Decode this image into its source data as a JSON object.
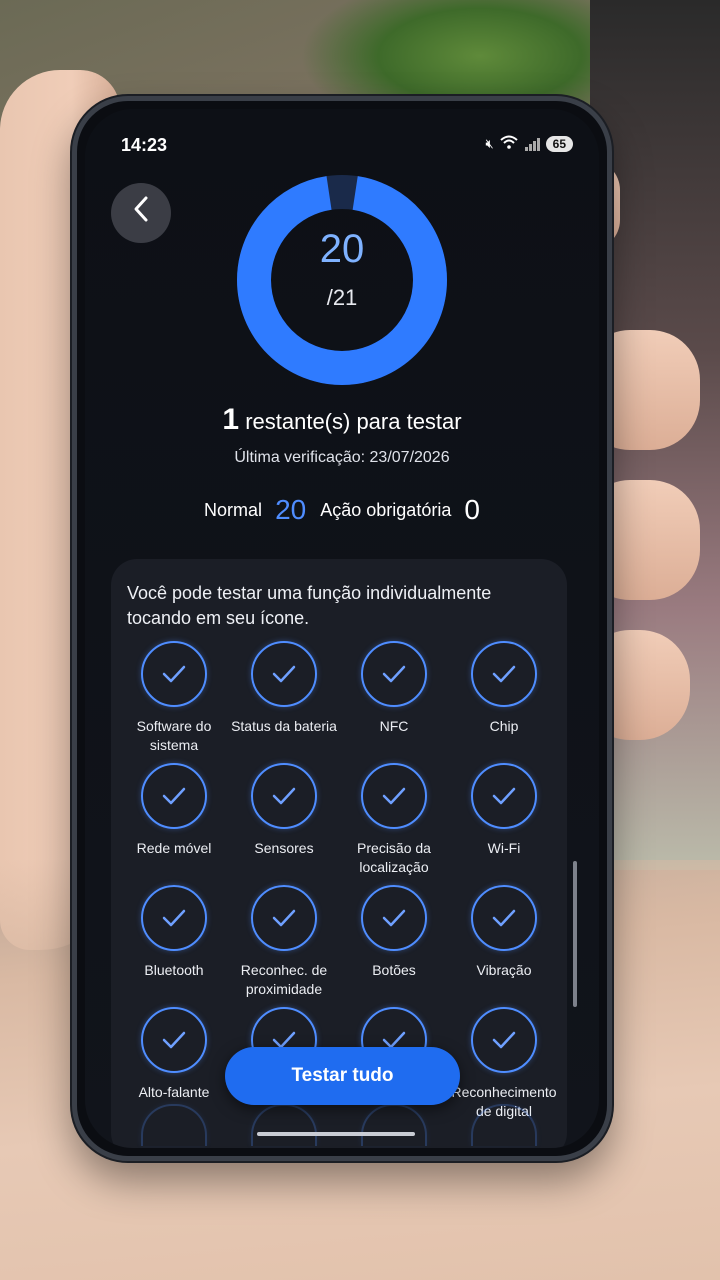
{
  "status_bar": {
    "time": "14:23",
    "battery": "65"
  },
  "progress": {
    "completed": "20",
    "total": "/21",
    "fraction": 0.952
  },
  "summary": {
    "remaining_count": "1",
    "remaining_text": "restante(s) para testar",
    "last_check": "Última verificação: 23/07/2026"
  },
  "counts": {
    "normal_label": "Normal",
    "normal_value": "20",
    "action_label": "Ação obrigatória",
    "action_value": "0"
  },
  "panel": {
    "description": "Você pode testar uma função individualmente tocando em seu ícone.",
    "items": [
      {
        "label": "Software do sistema"
      },
      {
        "label": "Status da bateria"
      },
      {
        "label": "NFC"
      },
      {
        "label": "Chip"
      },
      {
        "label": "Rede móvel"
      },
      {
        "label": "Sensores"
      },
      {
        "label": "Precisão da localização"
      },
      {
        "label": "Wi-Fi"
      },
      {
        "label": "Bluetooth"
      },
      {
        "label": "Reconhec. de proximidade"
      },
      {
        "label": "Botões"
      },
      {
        "label": "Vibração"
      },
      {
        "label": "Alto-falante"
      },
      {
        "label": ""
      },
      {
        "label": ""
      },
      {
        "label": "Reconhecimento de digital"
      }
    ]
  },
  "buttons": {
    "test_all": "Testar tudo",
    "back_icon": "chevron-left-icon"
  },
  "colors": {
    "accent": "#1f6cf0",
    "ring": "#2f7bff",
    "check": "#4f8dff"
  }
}
